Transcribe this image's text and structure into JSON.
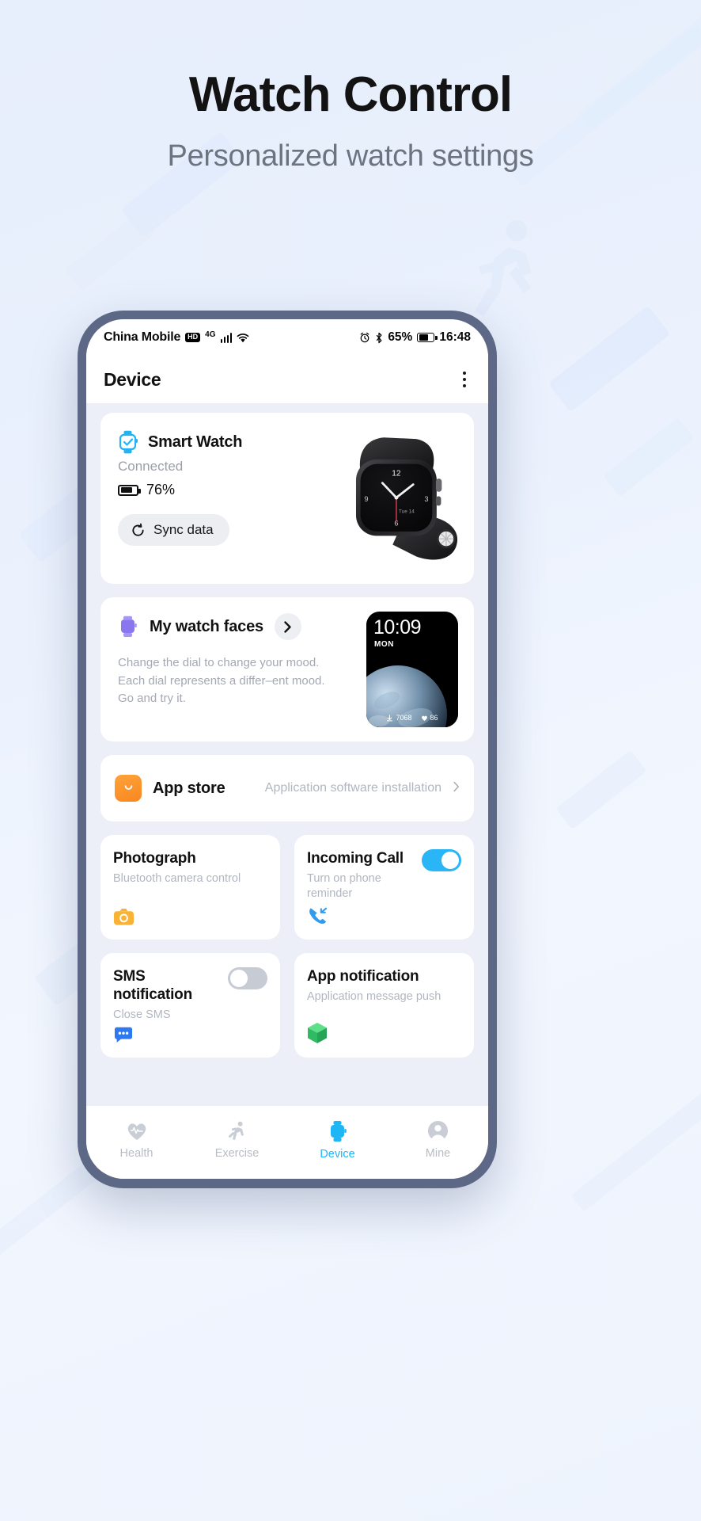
{
  "hero": {
    "title": "Watch Control",
    "subtitle": "Personalized watch settings"
  },
  "colors": {
    "accent": "#1fb6f5",
    "phone_frame": "#5c6885",
    "screen_bg": "#eceff7",
    "orange": "#f8871f",
    "purple": "#8a77ef",
    "green": "#3ecf6a",
    "toggle_on": "#2ab6f6",
    "toggle_off": "#c6cbd4"
  },
  "status_bar": {
    "carrier": "China Mobile",
    "hd_badge": "HD",
    "network": "4G",
    "signal_icon": "signal-bars-icon",
    "wifi_icon": "wifi-icon",
    "alarm_icon": "alarm-clock-icon",
    "bluetooth_icon": "bluetooth-icon",
    "battery_percent": "65%",
    "battery_icon": "battery-icon",
    "time": "16:48"
  },
  "app_bar": {
    "title": "Device",
    "menu_icon": "kebab-menu-icon"
  },
  "device_card": {
    "icon": "smart-watch-check-icon",
    "name": "Smart Watch",
    "status": "Connected",
    "battery_icon": "battery-icon",
    "battery_percent": "76%",
    "sync_icon": "sync-refresh-icon",
    "sync_label": "Sync data",
    "watch_image": "smart-watch-photo"
  },
  "watch_faces_card": {
    "icon": "watch-face-icon",
    "title": "My watch faces",
    "chevron_icon": "chevron-right-icon",
    "description": "Change the dial to change your mood. Each dial represents a differ–ent mood. Go and try it.",
    "preview": {
      "time": "10:09",
      "day": "MON",
      "downloads_icon": "download-icon",
      "downloads": "7068",
      "likes_icon": "heart-icon",
      "likes": "86"
    }
  },
  "app_store_card": {
    "icon": "shopping-bag-icon",
    "title": "App store",
    "subtitle": "Application software installation",
    "chevron_icon": "chevron-right-icon"
  },
  "tiles": [
    {
      "name": "photograph",
      "title": "Photograph",
      "subtitle": "Bluetooth camera control",
      "icon": "camera-icon",
      "has_toggle": false,
      "toggle_state": ""
    },
    {
      "name": "incoming-call",
      "title": "Incoming Call",
      "subtitle": "Turn on phone reminder",
      "icon": "phone-incoming-icon",
      "has_toggle": true,
      "toggle_state": "on"
    },
    {
      "name": "sms-notification",
      "title": "SMS notification",
      "subtitle": "Close SMS",
      "icon": "chat-bubble-icon",
      "has_toggle": true,
      "toggle_state": "off"
    },
    {
      "name": "app-notification",
      "title": "App notification",
      "subtitle": "Application message push",
      "icon": "green-cube-icon",
      "has_toggle": false,
      "toggle_state": ""
    }
  ],
  "tab_bar": {
    "items": [
      {
        "label": "Health",
        "icon": "heart-pulse-icon",
        "active": false
      },
      {
        "label": "Exercise",
        "icon": "running-person-icon",
        "active": false
      },
      {
        "label": "Device",
        "icon": "watch-icon",
        "active": true
      },
      {
        "label": "Mine",
        "icon": "person-circle-icon",
        "active": false
      }
    ]
  }
}
